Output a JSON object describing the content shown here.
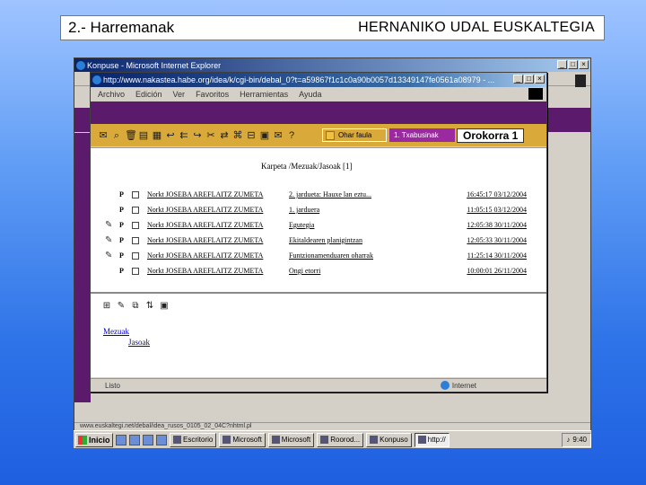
{
  "slide": {
    "title_left": "2.- Harremanak",
    "title_right": "HERNANIKO UDAL EUSKALTEGIA"
  },
  "outer_window": {
    "title": "Konpuse - Microsoft Internet Explorer",
    "status": "www.euskaltegi.net/debal/idea_rusos_0105_02_04C?nhtml.pl"
  },
  "taskbar": {
    "start_label": "Inicio",
    "tasks": [
      "Escritorio",
      "Microsoft",
      "Microsoft",
      "Roorod...",
      "Konpuso",
      "http://"
    ],
    "clock": "9:40"
  },
  "inner_window": {
    "title": "http://www.nakastea.habe.org/idea/k/cgi-bin/debal_0?t=a59867f1c1c0a90b0057d13349147fe0561a08979 - ...",
    "menu": [
      "Archivo",
      "Edición",
      "Ver",
      "Favoritos",
      "Herramientas",
      "Ayuda"
    ],
    "status_left": "Listo",
    "status_zone": "Internet"
  },
  "toolbar": {
    "tab_other": "Ohar faula",
    "tab_selected": "1. Txabusinak",
    "folder_label": "Orokorra 1"
  },
  "folder_heading": "Karpeta /Mezuak/Jasoak [1]",
  "messages": [
    {
      "icon": "",
      "priority": "P",
      "from": "Norkt JOSEBA AREFLAITZ ZUMETA",
      "subject": "2. jardueta: Hauxe lan eztu...",
      "date": "16:45:17 03/12/2004"
    },
    {
      "icon": "",
      "priority": "P",
      "from": "Norkt JOSEBA AREFLAITZ ZUMETA",
      "subject": "1. jarduera",
      "date": "11:05:15 03/12/2004"
    },
    {
      "icon": "✎",
      "priority": "P",
      "from": "Norkt JOSEBA AREFLAITZ ZUMETA",
      "subject": "Egutegia",
      "date": "12:05:38 30/11/2004"
    },
    {
      "icon": "✎",
      "priority": "P",
      "from": "Norkt JOSEBA AREFLAITZ ZUMETA",
      "subject": "Ekitaldearen planigintzan",
      "date": "12:05:33 30/11/2004"
    },
    {
      "icon": "✎",
      "priority": "P",
      "from": "Norkt JOSEBA AREFLAITZ ZUMETA",
      "subject": "Funtzionamenduaren oharrak",
      "date": "11:25:14 30/11/2004"
    },
    {
      "icon": "",
      "priority": "P",
      "from": "Norkt JOSEBA AREFLAITZ ZUMETA",
      "subject": "Ongi etorri",
      "date": "10:00:01 26/11/2004"
    }
  ],
  "tree": {
    "root": "Mezuak",
    "child": "Jasoak"
  }
}
